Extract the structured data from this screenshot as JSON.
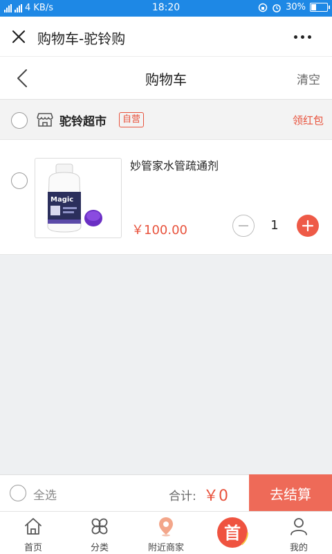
{
  "status_bar": {
    "network": "4 KB/s",
    "time": "18:20",
    "battery": "30%",
    "bg_color": "#1e88e5"
  },
  "app_bar": {
    "title": "购物车-驼铃购",
    "close_icon": "close-icon",
    "more_icon": "more-icon"
  },
  "page_header": {
    "title": "购物车",
    "clear_label": "清空",
    "back_icon": "back-chevron-icon"
  },
  "shop": {
    "name": "驼铃超市",
    "badge": "自营",
    "coupon_label": "领红包",
    "icon": "store-icon",
    "accent": "#e8523c"
  },
  "cart_items": [
    {
      "name": "妙管家水管疏通剂",
      "price": "￥100.00",
      "quantity": "1"
    }
  ],
  "footer": {
    "select_all_label": "全选",
    "total_label": "合计:",
    "total_value": "￥0",
    "checkout_label": "去结算",
    "checkout_color": "#ee6a58"
  },
  "tab_bar": {
    "tabs": [
      {
        "label": "首页",
        "icon": "home-icon"
      },
      {
        "label": "分类",
        "icon": "category-icon"
      },
      {
        "label": "附近商家",
        "icon": "location-pin-icon"
      },
      {
        "label": "",
        "icon": "center-logo-icon",
        "logo_char": "首"
      },
      {
        "label": "我的",
        "icon": "profile-icon"
      }
    ]
  }
}
